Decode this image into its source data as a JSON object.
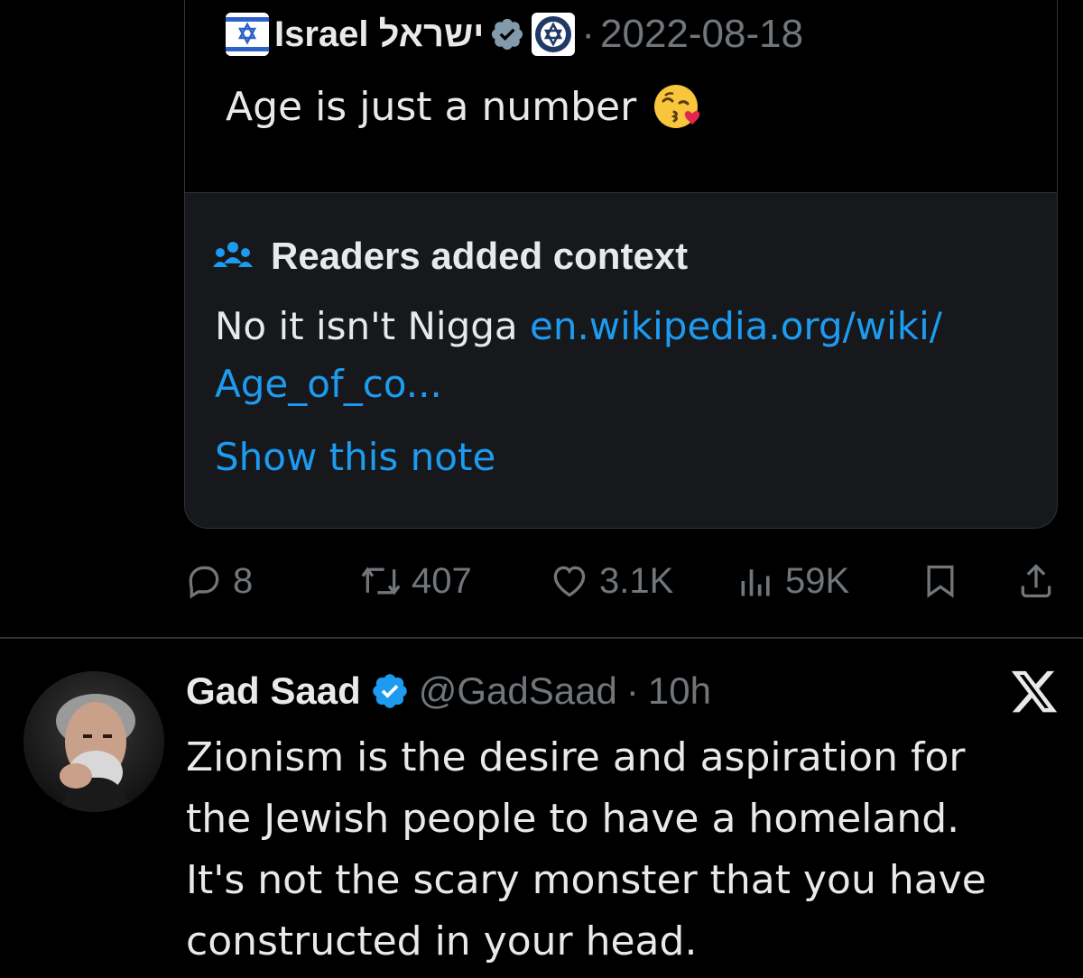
{
  "quoted_tweet": {
    "author_name": "Israel ישראל",
    "date_separator": "·",
    "date": "2022-08-18",
    "text": "Age is just a number",
    "emoji": "kissing-face-with-heart-emoji"
  },
  "note": {
    "title": "Readers added context",
    "body_text": "No it isn't Nigga ",
    "link_text_1": "en.wikipedia.org/wiki/",
    "link_text_2": "Age_of_co...",
    "show_label": "Show this note"
  },
  "actions": {
    "replies": "8",
    "reposts": "407",
    "likes": "3.1K",
    "views": "59K"
  },
  "tweet": {
    "author_name": "Gad Saad",
    "handle": "@GadSaad",
    "separator": "·",
    "time": "10h",
    "lines": [
      "Zionism is the desire and aspiration for",
      "the Jewish people to have a homeland.",
      "It's not the scary monster that you have",
      "constructed in your head."
    ]
  },
  "colors": {
    "background": "#000000",
    "text": "#e7e9ea",
    "muted": "#71767b",
    "link": "#1d9bf0",
    "note_bg": "#16181c",
    "border": "#2f3336"
  }
}
